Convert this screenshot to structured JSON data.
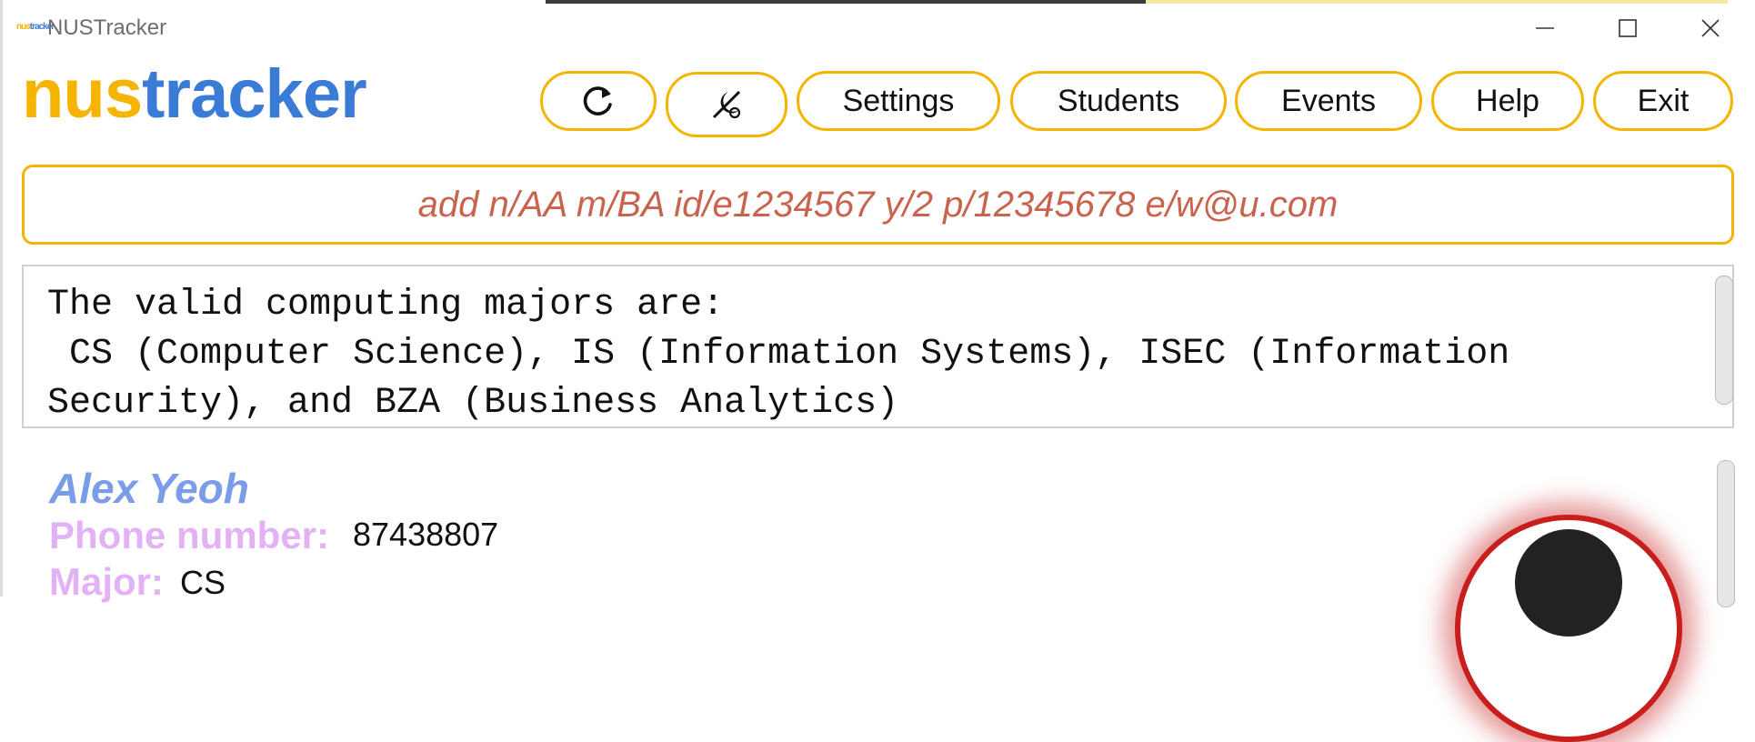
{
  "window": {
    "icon_label": "nustracker",
    "icon_nus": "nus",
    "icon_tracker": "tracker",
    "title": "NUSTracker",
    "controls": [
      "minimize-icon",
      "maximize-icon",
      "close-icon"
    ]
  },
  "brand": {
    "nus": "nus",
    "tracker": "tracker"
  },
  "toolbar": {
    "refresh_icon": "refresh-icon",
    "theme_icon": "theme-toggle-icon",
    "buttons": [
      {
        "label": "Settings"
      },
      {
        "label": "Students"
      },
      {
        "label": "Events"
      },
      {
        "label": "Help"
      },
      {
        "label": "Exit"
      }
    ]
  },
  "command": {
    "value": "add n/AA m/BA id/e1234567 y/2 p/12345678 e/w@u.com"
  },
  "result": {
    "text": "The valid computing majors are:\n CS (Computer Science), IS (Information Systems), ISEC (Information Security), and BZA (Business Analytics)"
  },
  "students": [
    {
      "name": "Alex Yeoh",
      "phone_label": "Phone number:",
      "phone": "87438807",
      "major_label": "Major:",
      "major": "CS"
    }
  ],
  "colors": {
    "accent_yellow": "#f5b400",
    "accent_blue": "#3a7bd5",
    "command_text": "#c8644e",
    "name_color": "#7b9ce9",
    "label_color": "#e3b2f5",
    "avatar_ring": "#c81e1e"
  }
}
